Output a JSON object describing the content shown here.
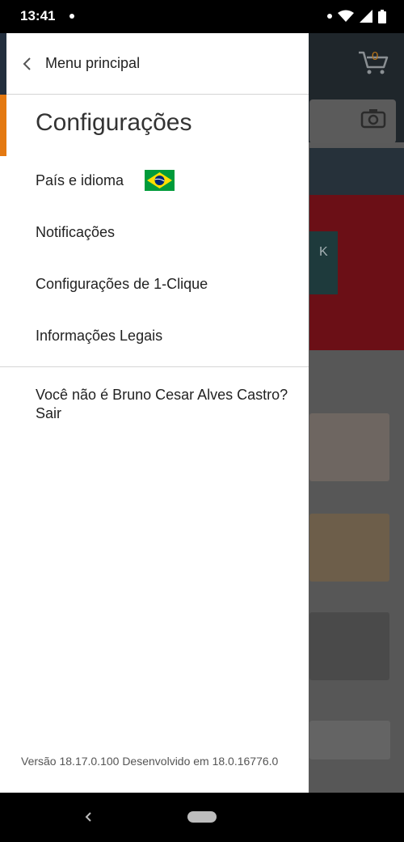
{
  "status_bar": {
    "time": "13:41",
    "icons": [
      "notification-dot-icon",
      "wifi-icon",
      "signal-icon",
      "battery-icon"
    ]
  },
  "background_app": {
    "cart_count": "0",
    "cart_icon": "cart-icon",
    "camera_icon": "camera-icon",
    "banner_letter": "K",
    "colors": {
      "header": "#1f262b",
      "accent_cart": "#e47911",
      "banner": "#6b0f16"
    }
  },
  "drawer": {
    "back_label": "Menu principal",
    "back_icon": "chevron-left-icon",
    "section_title": "Configurações",
    "accent_color": "#e47911",
    "items": [
      {
        "label": "País e idioma",
        "flag": "brazil-flag-icon"
      },
      {
        "label": "Notificações"
      },
      {
        "label": "Configurações de 1-Clique"
      },
      {
        "label": "Informações Legais"
      }
    ],
    "signout_text": "Você não é Bruno Cesar Alves Castro? Sair",
    "version_text": "Versão 18.17.0.100  Desenvolvido em 18.0.16776.0"
  },
  "nav_bar": {
    "back_icon": "nav-back-icon",
    "home_icon": "home-pill-icon"
  }
}
